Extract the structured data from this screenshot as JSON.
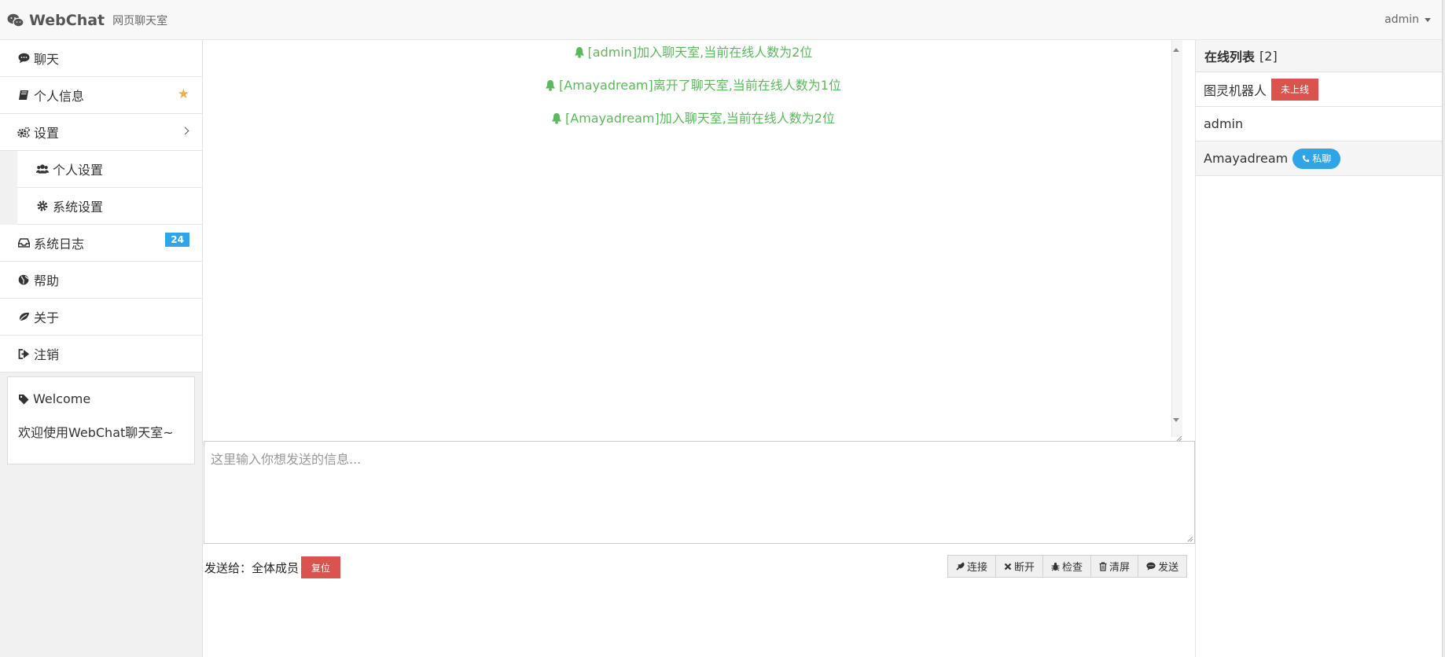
{
  "navbar": {
    "brand_name": "WebChat",
    "brand_sub": "网页聊天室",
    "user": "admin"
  },
  "sidebar": {
    "items": [
      {
        "label": "聊天",
        "icon": "comment-icon"
      },
      {
        "label": "个人信息",
        "icon": "book-icon",
        "marker": "star-icon"
      },
      {
        "label": "设置",
        "icon": "cogs-icon"
      },
      {
        "label": "个人设置",
        "icon": "users-icon"
      },
      {
        "label": "系统设置",
        "icon": "cog-icon"
      },
      {
        "label": "系统日志",
        "icon": "inbox-icon",
        "badge": "24"
      },
      {
        "label": "帮助",
        "icon": "globe-icon"
      },
      {
        "label": "关于",
        "icon": "leaf-icon"
      },
      {
        "label": "注销",
        "icon": "sign-out-icon"
      }
    ],
    "welcome": {
      "title": "Welcome",
      "text": "欢迎使用WebChat聊天室~"
    }
  },
  "chat": {
    "messages": [
      "[admin]加入聊天室,当前在线人数为2位",
      "[Amayadream]离开了聊天室,当前在线人数为1位",
      "[Amayadream]加入聊天室,当前在线人数为2位"
    ],
    "input_placeholder": "这里输入你想发送的信息...",
    "send_to_label": "发送给：全体成员",
    "reset_label": "复位",
    "buttons": [
      "连接",
      "断开",
      "检查",
      "清屏",
      "发送"
    ]
  },
  "online": {
    "title": "在线列表",
    "count": "[2]",
    "users": [
      {
        "name": "图灵机器人",
        "tag": "未上线"
      },
      {
        "name": "admin"
      },
      {
        "name": "Amayadream",
        "tag": "私聊"
      }
    ]
  },
  "colors": {
    "system_message": "#5cb85c",
    "badge": "#2fa4e7",
    "danger": "#d9534f",
    "star": "#f0ad4e"
  }
}
